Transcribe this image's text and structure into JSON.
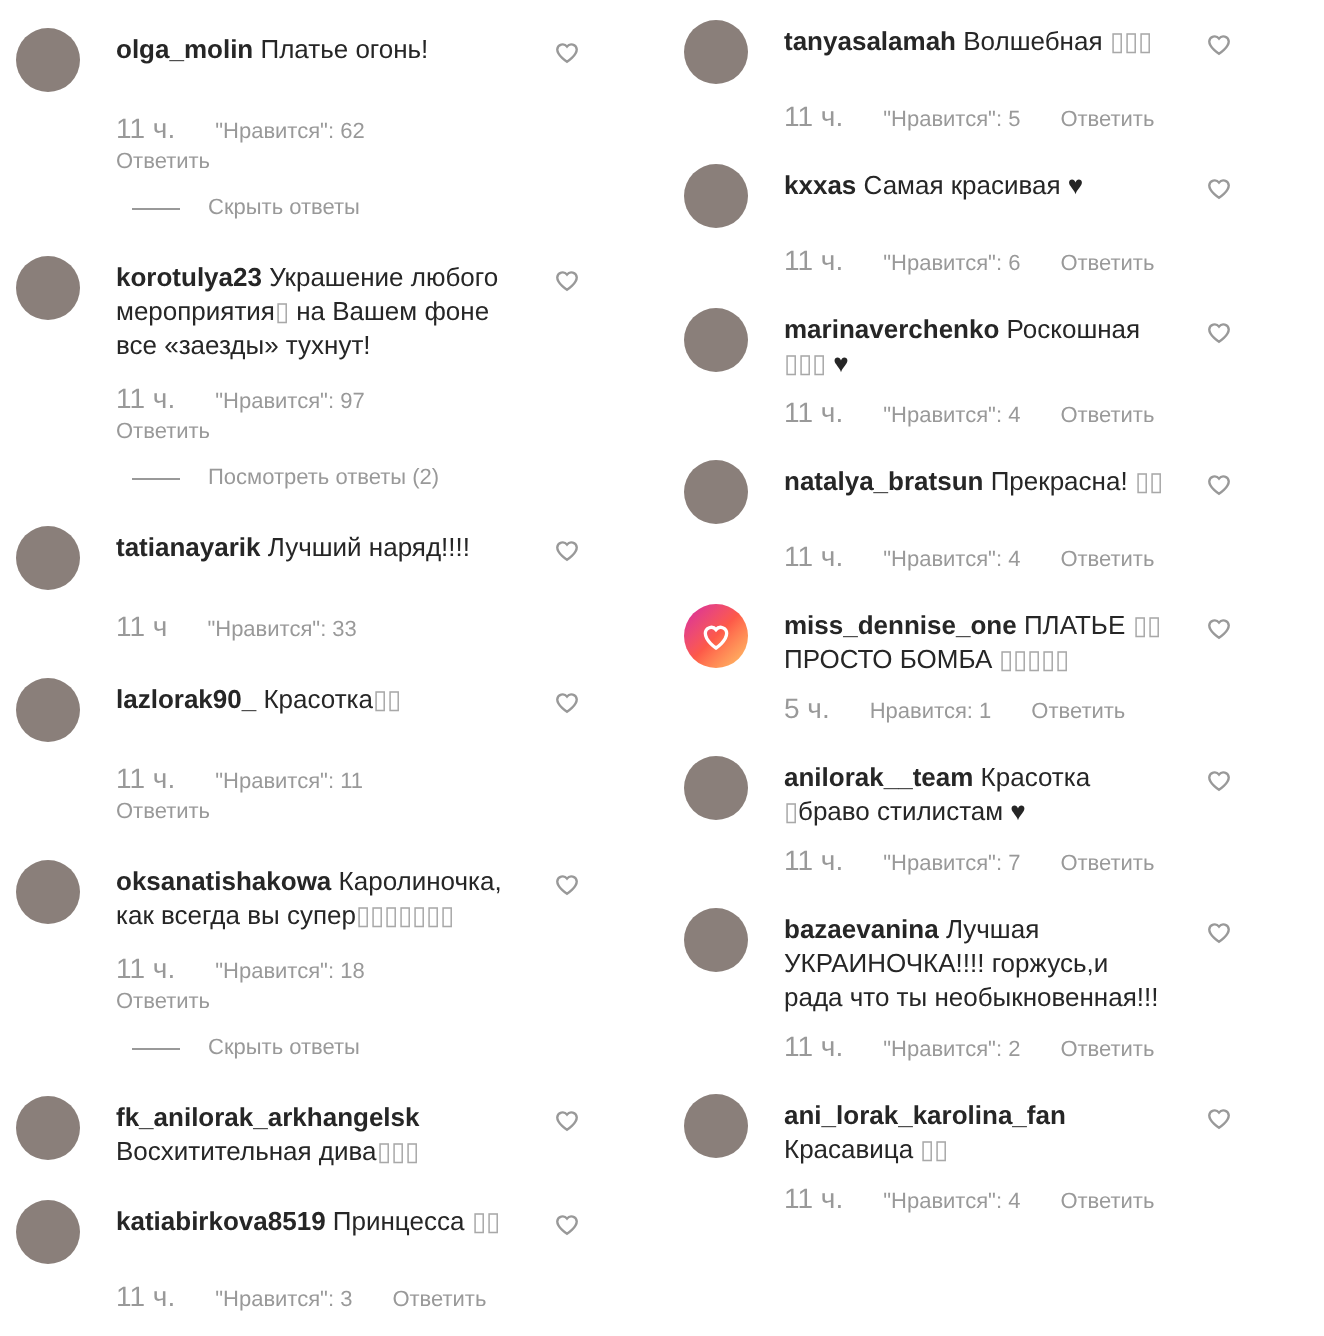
{
  "columns": [
    {
      "comments": [
        {
          "user": "olga_molin",
          "avatar": {
            "kind": "photo"
          },
          "parts": [
            {
              "kind": "text",
              "t": "Платье огонь!"
            }
          ],
          "meta": {
            "kind": "stacked",
            "time": "11 ч.",
            "likes": "\"Нравится\": 62",
            "reply": "Ответить"
          },
          "thread_toggle": "Скрыть ответы"
        },
        {
          "user": "korotulya23",
          "avatar": {
            "kind": "photo"
          },
          "parts": [
            {
              "kind": "text",
              "t": "Украшение любого мероприятия"
            },
            {
              "kind": "missing",
              "t": "▯"
            },
            {
              "kind": "text",
              "t": " на Вашем фоне все «заезды» тухнут!"
            }
          ],
          "meta": {
            "kind": "stacked",
            "time": "11 ч.",
            "likes": "\"Нравится\": 97",
            "reply": "Ответить"
          },
          "thread_toggle": "Посмотреть ответы (2)"
        },
        {
          "user": "tatianayarik",
          "avatar": {
            "kind": "photo"
          },
          "parts": [
            {
              "kind": "text",
              "t": "Лучший наряд!!!!"
            }
          ],
          "meta": {
            "kind": "stacked",
            "time": "11 ч",
            "likes": "\"Нравится\": 33"
          }
        },
        {
          "user": "lazlorak90_",
          "avatar": {
            "kind": "photo"
          },
          "parts": [
            {
              "kind": "text",
              "t": "Красотка"
            },
            {
              "kind": "missing",
              "t": "▯▯"
            }
          ],
          "meta": {
            "kind": "stacked",
            "time": "11 ч.",
            "likes": "\"Нравится\": 11",
            "reply": "Ответить"
          }
        },
        {
          "user": "oksanatishakowa",
          "avatar": {
            "kind": "photo"
          },
          "parts": [
            {
              "kind": "text",
              "t": "Каролиночка, как всегда вы супер"
            },
            {
              "kind": "missing",
              "t": "▯▯▯▯▯▯▯"
            }
          ],
          "meta": {
            "kind": "stacked",
            "time": "11 ч.",
            "likes": "\"Нравится\": 18",
            "reply": "Ответить"
          },
          "thread_toggle": "Скрыть ответы"
        },
        {
          "user": "fk_anilorak_arkhangelsk",
          "avatar": {
            "kind": "photo"
          },
          "parts": [
            {
              "kind": "text",
              "t": "Восхитительная дива"
            },
            {
              "kind": "missing",
              "t": "▯▯▯"
            }
          ]
        },
        {
          "user": "katiabirkova8519",
          "avatar": {
            "kind": "photo"
          },
          "parts": [
            {
              "kind": "text",
              "t": "Принцесса "
            },
            {
              "kind": "missing",
              "t": "▯▯"
            }
          ],
          "meta": {
            "kind": "inline",
            "time": "11 ч.",
            "likes": "\"Нравится\": 3",
            "reply": "Ответить"
          }
        }
      ]
    },
    {
      "comments": [
        {
          "user": "tanyasalamah",
          "avatar": {
            "kind": "photo"
          },
          "parts": [
            {
              "kind": "text",
              "t": "Волшебная "
            },
            {
              "kind": "missing",
              "t": "▯▯▯"
            }
          ],
          "meta": {
            "kind": "inline",
            "time": "11 ч.",
            "likes": "\"Нравится\": 5",
            "reply": "Ответить"
          }
        },
        {
          "user": "kxxas",
          "avatar": {
            "kind": "photo"
          },
          "parts": [
            {
              "kind": "text",
              "t": "Самая красивая ♥"
            }
          ],
          "meta": {
            "kind": "inline",
            "time": "11 ч.",
            "likes": "\"Нравится\": 6",
            "reply": "Ответить"
          }
        },
        {
          "user": "marinaverchenko",
          "avatar": {
            "kind": "photo"
          },
          "parts": [
            {
              "kind": "text",
              "t": "Роскошная "
            },
            {
              "kind": "missing",
              "t": "▯▯▯"
            },
            {
              "kind": "text",
              "t": " ♥"
            }
          ],
          "meta": {
            "kind": "inline",
            "time": "11 ч.",
            "likes": "\"Нравится\": 4",
            "reply": "Ответить"
          }
        },
        {
          "user": "natalya_bratsun",
          "avatar": {
            "kind": "photo"
          },
          "parts": [
            {
              "kind": "text",
              "t": "Прекрасна! "
            },
            {
              "kind": "missing",
              "t": "▯▯"
            }
          ],
          "meta": {
            "kind": "inline",
            "time": "11 ч.",
            "likes": "\"Нравится\": 4",
            "reply": "Ответить"
          }
        },
        {
          "user": "miss_dennise_one",
          "avatar": {
            "kind": "heart-logo"
          },
          "parts": [
            {
              "kind": "text",
              "t": "ПЛАТЬЕ "
            },
            {
              "kind": "missing",
              "t": "▯▯"
            },
            {
              "kind": "text",
              "t": " ПРОСТО БОМБА "
            },
            {
              "kind": "missing",
              "t": "▯▯▯▯▯"
            }
          ],
          "meta": {
            "kind": "inline",
            "time": "5 ч.",
            "likes": "Нравится: 1",
            "reply": "Ответить"
          }
        },
        {
          "user": "anilorak__team",
          "avatar": {
            "kind": "photo"
          },
          "parts": [
            {
              "kind": "text",
              "t": "Красотка "
            },
            {
              "kind": "missing",
              "t": "▯"
            },
            {
              "kind": "text",
              "t": "браво стилистам ♥"
            }
          ],
          "meta": {
            "kind": "inline",
            "time": "11 ч.",
            "likes": "\"Нравится\": 7",
            "reply": "Ответить"
          }
        },
        {
          "user": "bazaevanina",
          "avatar": {
            "kind": "photo"
          },
          "parts": [
            {
              "kind": "text",
              "t": "Лучшая УКРАИНОЧКА!!!! горжусь,и рада что ты необыкновенная!!!"
            }
          ],
          "meta": {
            "kind": "inline",
            "time": "11 ч.",
            "likes": "\"Нравится\": 2",
            "reply": "Ответить"
          }
        },
        {
          "user": "ani_lorak_karolina_fan",
          "avatar": {
            "kind": "photo"
          },
          "parts": [
            {
              "kind": "text",
              "t": "Красавица "
            },
            {
              "kind": "missing",
              "t": "▯▯"
            }
          ],
          "meta": {
            "kind": "inline",
            "time": "11 ч.",
            "likes": "\"Нравится\": 4",
            "reply": "Ответить"
          }
        }
      ]
    }
  ]
}
